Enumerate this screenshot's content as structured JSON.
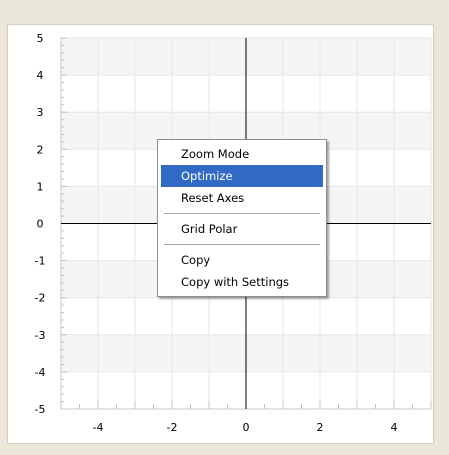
{
  "plot": {
    "x_range": [
      -5,
      5
    ],
    "y_range": [
      -5,
      5
    ],
    "x_tick_labels": [
      "-4",
      "-2",
      "0",
      "2",
      "4"
    ],
    "x_tick_values": [
      -4,
      -2,
      0,
      2,
      4
    ],
    "y_tick_labels": [
      "5",
      "4",
      "3",
      "2",
      "1",
      "0",
      "-1",
      "-2",
      "-3",
      "-4",
      "-5"
    ],
    "y_tick_values": [
      5,
      4,
      3,
      2,
      1,
      0,
      -1,
      -2,
      -3,
      -4,
      -5
    ],
    "grid": true,
    "background": "#ffffff",
    "band_color": "#f5f5f5",
    "grid_color": "#e6e6e6",
    "axis_color": "#000000"
  },
  "context_menu": {
    "items": [
      {
        "label": "Zoom Mode"
      },
      {
        "label": "Optimize",
        "selected": true
      },
      {
        "label": "Reset Axes"
      },
      {
        "separator": true
      },
      {
        "label": "Grid Polar"
      },
      {
        "separator": true
      },
      {
        "label": "Copy"
      },
      {
        "label": "Copy with Settings"
      }
    ],
    "selected_color": "#316ac5"
  }
}
